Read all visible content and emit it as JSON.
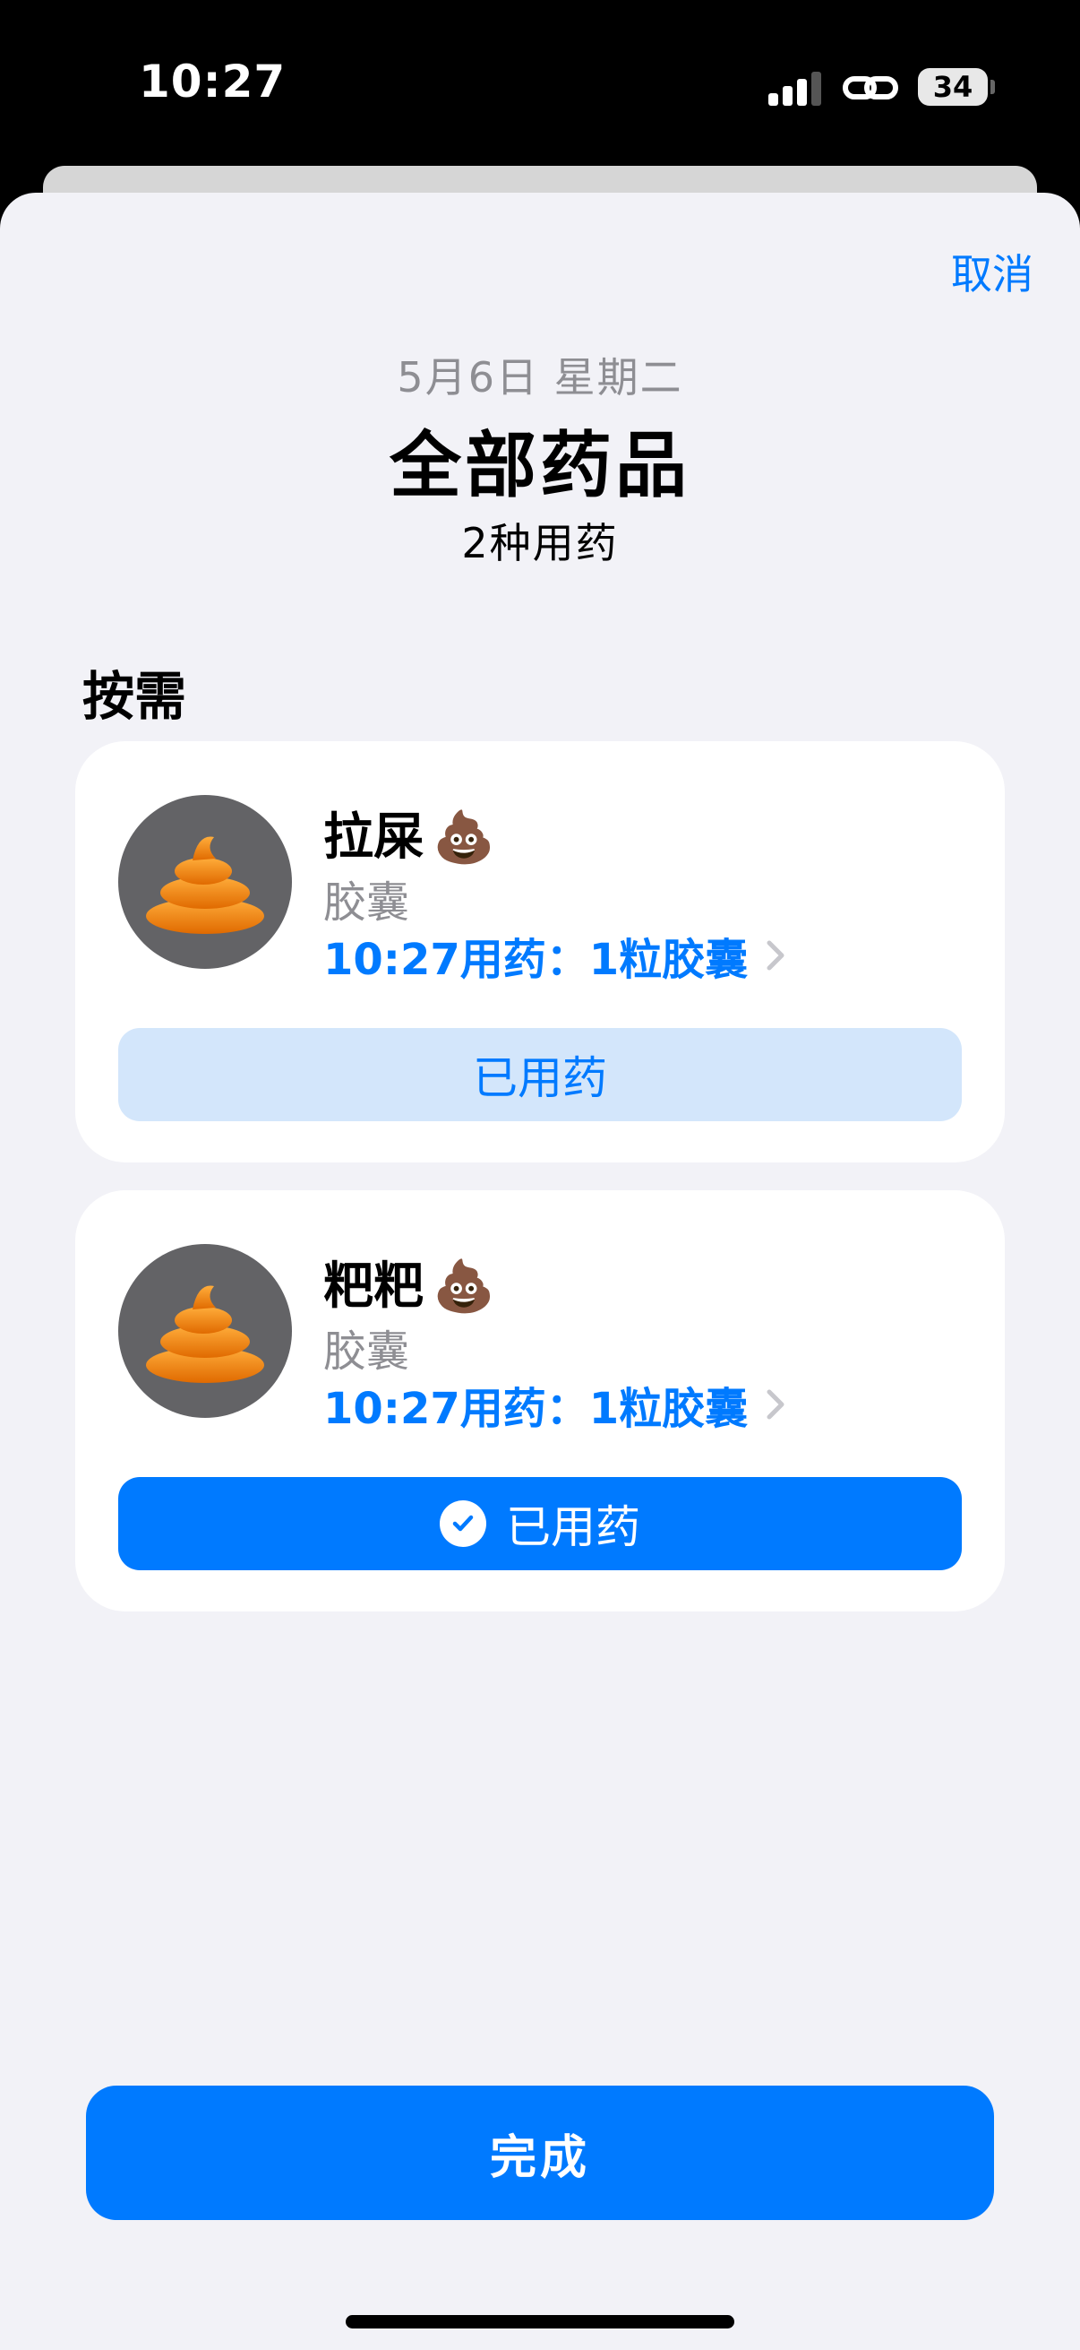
{
  "status_bar": {
    "time": "10:27",
    "battery": "34"
  },
  "header": {
    "cancel_label": "取消",
    "date": "5月6日 星期二",
    "title": "全部药品",
    "subtitle": "2种用药"
  },
  "section": {
    "title": "按需"
  },
  "medications": [
    {
      "name": "拉屎",
      "emoji": "💩",
      "type": "胶囊",
      "dose": "10:27用药：1粒胶囊",
      "action_label": "已用药",
      "taken": false
    },
    {
      "name": "粑粑",
      "emoji": "💩",
      "type": "胶囊",
      "dose": "10:27用药：1粒胶囊",
      "action_label": "已用药",
      "taken": true
    }
  ],
  "footer": {
    "done_label": "完成"
  },
  "colors": {
    "accent": "#007aff",
    "accent_light": "#d3e6fb",
    "background": "#f2f2f7",
    "secondary_text": "#8e8e93"
  }
}
